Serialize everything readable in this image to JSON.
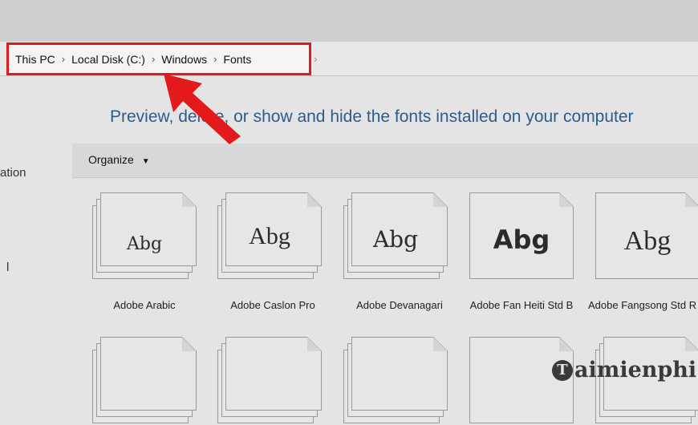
{
  "breadcrumb": {
    "items": [
      "This PC",
      "Local Disk (C:)",
      "Windows",
      "Fonts"
    ],
    "separator": "›"
  },
  "heading": "Preview, delete, or show and hide the fonts installed on your computer",
  "toolbar": {
    "organize_label": "Organize",
    "organize_caret": "▼"
  },
  "sidebar": {
    "partial_item_1": "ation",
    "partial_item_2": "l"
  },
  "fonts": [
    {
      "name": "Adobe Arabic",
      "sample": "Abg"
    },
    {
      "name": "Adobe Caslon Pro",
      "sample": "Abg"
    },
    {
      "name": "Adobe Devanagari",
      "sample": "Abg"
    },
    {
      "name": "Adobe Fan Heiti Std B",
      "sample": "Abg"
    },
    {
      "name": "Adobe Fangsong Std R",
      "sample": "Abg"
    }
  ],
  "watermark": {
    "logo_letter": "T",
    "text": "aimienphi"
  },
  "colors": {
    "highlight": "#e3191b",
    "heading": "#2a5d8f"
  }
}
